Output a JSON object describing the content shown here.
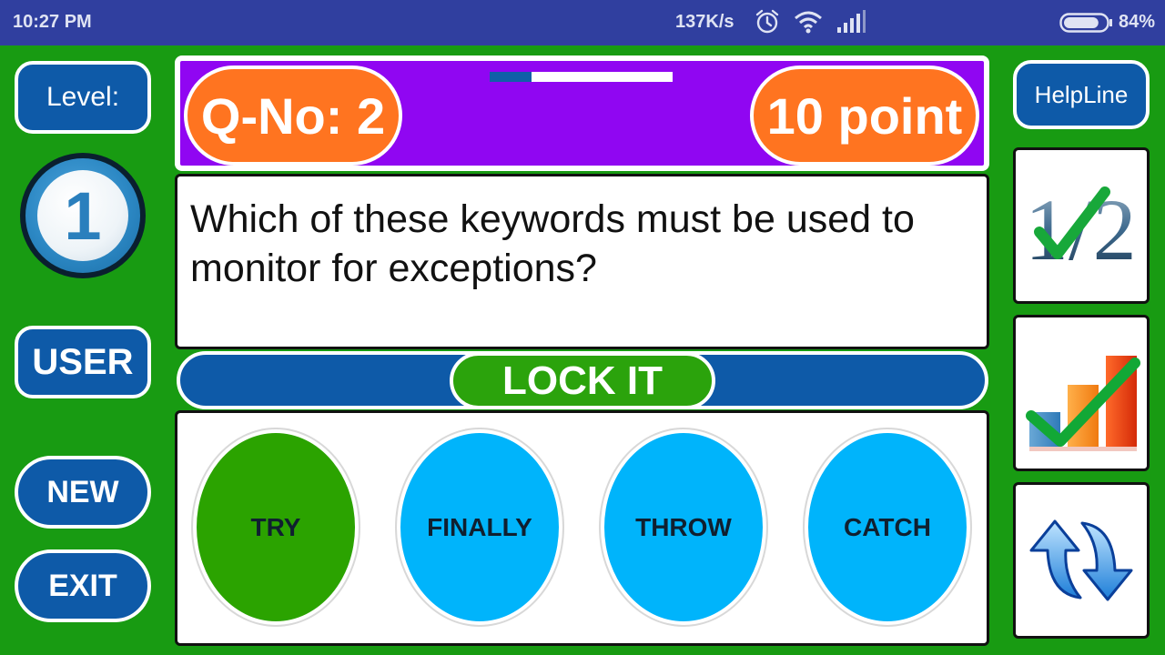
{
  "status_bar": {
    "time": "10:27 PM",
    "net_speed": "137K/s",
    "battery_percent": "84%",
    "battery_level": 0.84,
    "icons": [
      "alarm-icon",
      "wifi-icon",
      "signal-icon",
      "battery-icon"
    ]
  },
  "left_panel": {
    "level_label": "Level:",
    "level_value": "1",
    "user_label": "USER",
    "new_label": "NEW",
    "exit_label": "EXIT"
  },
  "header": {
    "question_number": "Q-No: 2",
    "points": "10 point",
    "timer_progress": 0.23
  },
  "question": {
    "text": "Which of these keywords must be used to monitor for exceptions?"
  },
  "lock_button": {
    "label": "LOCK IT"
  },
  "options": [
    {
      "label": "TRY",
      "color": "#2ba300"
    },
    {
      "label": "FINALLY",
      "color": "#00b4fb"
    },
    {
      "label": "THROW",
      "color": "#00b4fb"
    },
    {
      "label": "CATCH",
      "color": "#00b4fb"
    }
  ],
  "helpline": {
    "title": "HelpLine",
    "lifelines": [
      {
        "name": "fifty-fifty-icon",
        "text": "1/2"
      },
      {
        "name": "audience-poll-icon"
      },
      {
        "name": "swap-question-icon"
      }
    ]
  },
  "colors": {
    "background": "#189b12",
    "status_bar": "#303f9f",
    "header": "#9006f2",
    "button_blue": "#0e5aa8",
    "orange": "#ff7420",
    "lock_green": "#2ba30c"
  }
}
